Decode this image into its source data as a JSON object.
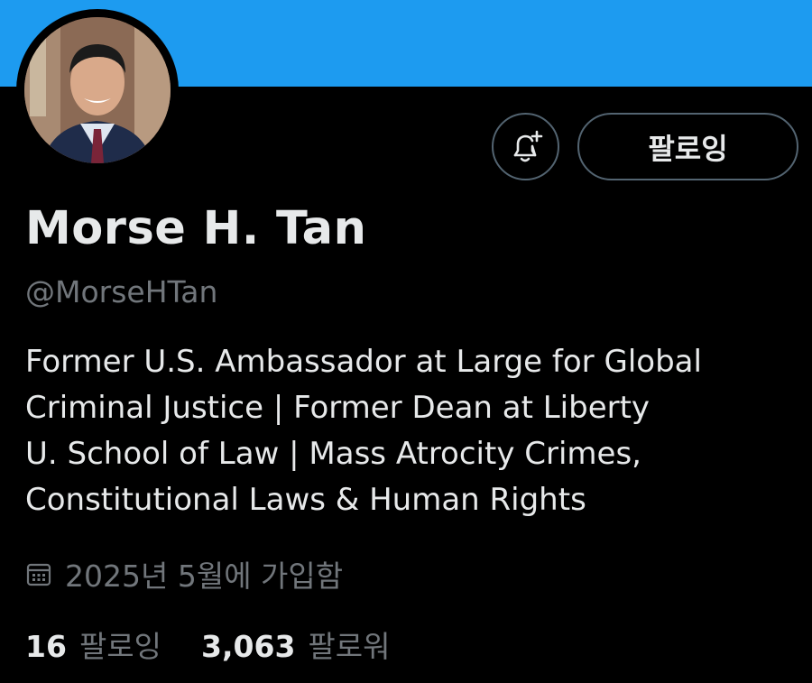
{
  "colors": {
    "banner": "#1d9bf0",
    "background": "#000000",
    "primary_text": "#e7e9ea",
    "secondary_text": "#71767b",
    "button_border": "#536471"
  },
  "profile": {
    "avatar_icon": "profile-photo",
    "name": "Morse H. Tan",
    "handle": "@MorseHTan",
    "bio": "Former U.S. Ambassador at Large for Global\nCriminal Justice | Former Dean at Liberty\nU. School of Law | Mass Atrocity Crimes,\nConstitutional Laws & Human Rights",
    "joined_icon": "calendar-icon",
    "joined": "2025년 5월에 가입함"
  },
  "actions": {
    "notify_icon": "bell-plus-icon",
    "follow_label": "팔로잉"
  },
  "stats": {
    "following_count": "16",
    "following_label": "팔로잉",
    "followers_count": "3,063",
    "followers_label": "팔로워"
  }
}
